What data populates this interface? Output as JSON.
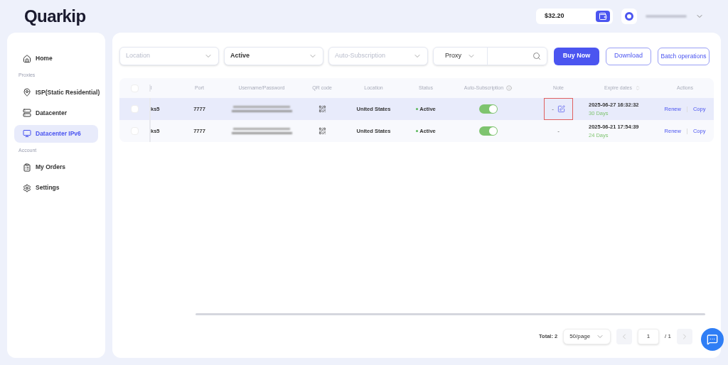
{
  "logo": {
    "text": "Quarkip"
  },
  "header": {
    "balance": "$32.20"
  },
  "sidebar": {
    "items": [
      {
        "label": "Home",
        "kind": "item",
        "selected": false
      },
      {
        "label": "Proxies",
        "kind": "section"
      },
      {
        "label": "ISP(Static Residential)",
        "kind": "item",
        "selected": false
      },
      {
        "label": "Datacenter",
        "kind": "item",
        "selected": false
      },
      {
        "label": "Datacenter IPv6",
        "kind": "item",
        "selected": true
      },
      {
        "label": "Account",
        "kind": "section"
      },
      {
        "label": "My Orders",
        "kind": "item",
        "selected": false
      },
      {
        "label": "Settings",
        "kind": "item",
        "selected": false
      }
    ]
  },
  "filters": {
    "location": {
      "placeholder": "Location"
    },
    "status": {
      "value": "Active"
    },
    "auto_subscription": {
      "placeholder": "Auto-Subscription"
    },
    "search_type": {
      "value": "Proxy"
    }
  },
  "buttons": {
    "buy": "Buy Now",
    "download": "Download",
    "batch": "Batch operations"
  },
  "table": {
    "all_selected": false,
    "columns": [
      "l",
      "Port",
      "Username/Password",
      "QR code",
      "Location",
      "Status",
      "Auto-Subscription",
      "Note",
      "Expire dates",
      "Actions"
    ],
    "rows": [
      {
        "selected": false,
        "highlighted": true,
        "protocol": "ks5",
        "port": "7777",
        "location": "United States",
        "status": "Active",
        "auto_subscription": true,
        "note": "-",
        "note_marked": true,
        "expire": "2025-06-27 16:32:32",
        "days": "30 Days",
        "actions": [
          "Renew",
          "Copy"
        ]
      },
      {
        "selected": false,
        "highlighted": false,
        "protocol": "ks5",
        "port": "7777",
        "location": "United States",
        "status": "Active",
        "auto_subscription": true,
        "note": "-",
        "note_marked": false,
        "expire": "2025-06-21 17:54:39",
        "days": "24 Days",
        "actions": [
          "Renew",
          "Copy"
        ]
      }
    ]
  },
  "pagination": {
    "total": "Total: 2",
    "page_size": "50/page",
    "page": "1",
    "pages": "/ 1"
  }
}
